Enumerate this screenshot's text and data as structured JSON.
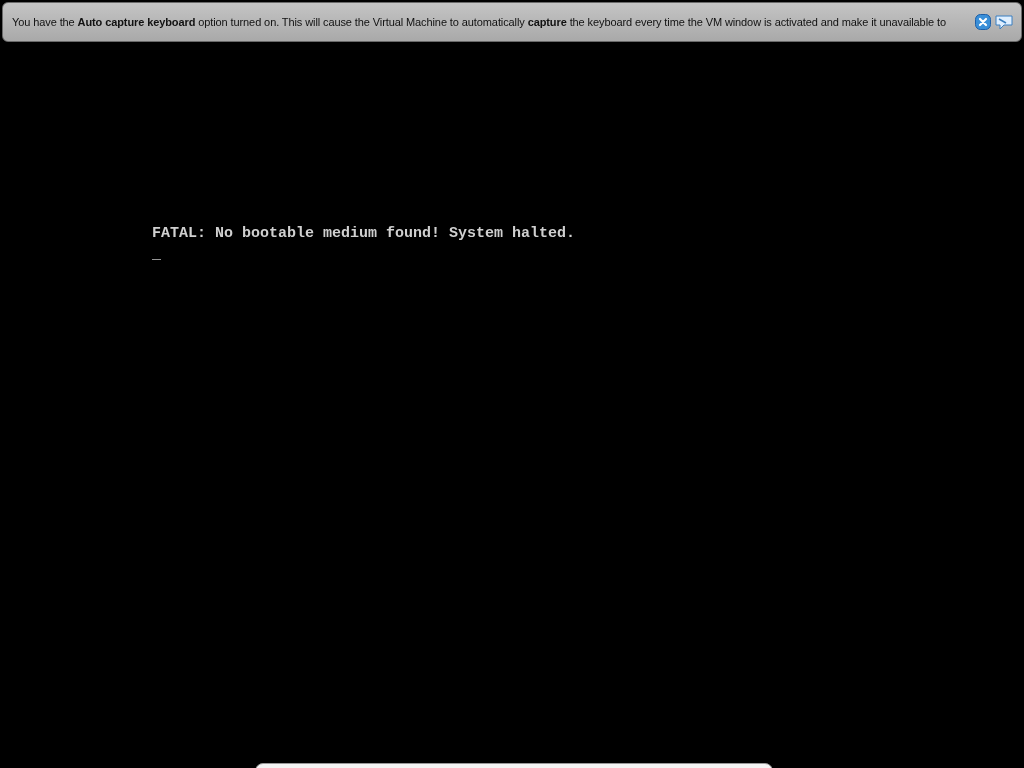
{
  "notification": {
    "message": "You have the **Auto capture keyboard** option turned on. This will cause the Virtual Machine to automatically **capture** the keyboard every time the VM window is activated and make it unavailable to"
  },
  "console": {
    "lines": [
      "FATAL: No bootable medium found! System halted.",
      "_"
    ]
  }
}
